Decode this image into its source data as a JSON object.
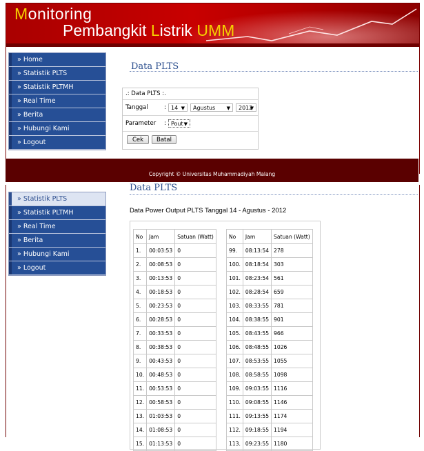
{
  "top": {
    "banner": {
      "word1_first": "M",
      "word1_rest": "onitoring",
      "word2_main": "Pembangkit ",
      "word2_l": "L",
      "word2_mid": "istrik ",
      "word2_umm": "UMM"
    },
    "sidebar": [
      "» Home",
      "» Statistik PLTS",
      "» Statistik PLTMH",
      "» Real Time",
      "» Berita",
      "» Hubungi Kami",
      "» Logout"
    ],
    "heading": "Data PLTS",
    "form": {
      "title": ".: Data PLTS :.",
      "tanggal_label": "Tanggal",
      "day": "14",
      "month": "Agustus",
      "year": "2012",
      "parameter_label": "Parameter",
      "parameter": "Pout",
      "colon": ":",
      "cek": "Cek",
      "batal": "Batal"
    },
    "footer": "Copyright © Universitas Muhammadiyah Malang"
  },
  "bottom": {
    "sidebar": [
      "» Statistik PLTS",
      "» Statistik PLTMH",
      "» Real Time",
      "» Berita",
      "» Hubungi Kami",
      "» Logout"
    ],
    "heading": "Data PLTS",
    "subtitle": "Data Power Output PLTS Tanggal 14 - Agustus - 2012",
    "table_headers": [
      "No",
      "Jam",
      "Satuan (Watt)"
    ],
    "left_rows": [
      [
        "1.",
        "00:03:53",
        "0"
      ],
      [
        "2.",
        "00:08:53",
        "0"
      ],
      [
        "3.",
        "00:13:53",
        "0"
      ],
      [
        "4.",
        "00:18:53",
        "0"
      ],
      [
        "5.",
        "00:23:53",
        "0"
      ],
      [
        "6.",
        "00:28:53",
        "0"
      ],
      [
        "7.",
        "00:33:53",
        "0"
      ],
      [
        "8.",
        "00:38:53",
        "0"
      ],
      [
        "9.",
        "00:43:53",
        "0"
      ],
      [
        "10.",
        "00:48:53",
        "0"
      ],
      [
        "11.",
        "00:53:53",
        "0"
      ],
      [
        "12.",
        "00:58:53",
        "0"
      ],
      [
        "13.",
        "01:03:53",
        "0"
      ],
      [
        "14.",
        "01:08:53",
        "0"
      ],
      [
        "15.",
        "01:13:53",
        "0"
      ]
    ],
    "right_rows": [
      [
        "99.",
        "08:13:54",
        "278"
      ],
      [
        "100.",
        "08:18:54",
        "303"
      ],
      [
        "101.",
        "08:23:54",
        "561"
      ],
      [
        "102.",
        "08:28:54",
        "659"
      ],
      [
        "103.",
        "08:33:55",
        "781"
      ],
      [
        "104.",
        "08:38:55",
        "901"
      ],
      [
        "105.",
        "08:43:55",
        "966"
      ],
      [
        "106.",
        "08:48:55",
        "1026"
      ],
      [
        "107.",
        "08:53:55",
        "1055"
      ],
      [
        "108.",
        "08:58:55",
        "1098"
      ],
      [
        "109.",
        "09:03:55",
        "1116"
      ],
      [
        "110.",
        "09:08:55",
        "1146"
      ],
      [
        "111.",
        "09:13:55",
        "1174"
      ],
      [
        "112.",
        "09:18:55",
        "1194"
      ],
      [
        "113.",
        "09:23:55",
        "1180"
      ]
    ]
  }
}
